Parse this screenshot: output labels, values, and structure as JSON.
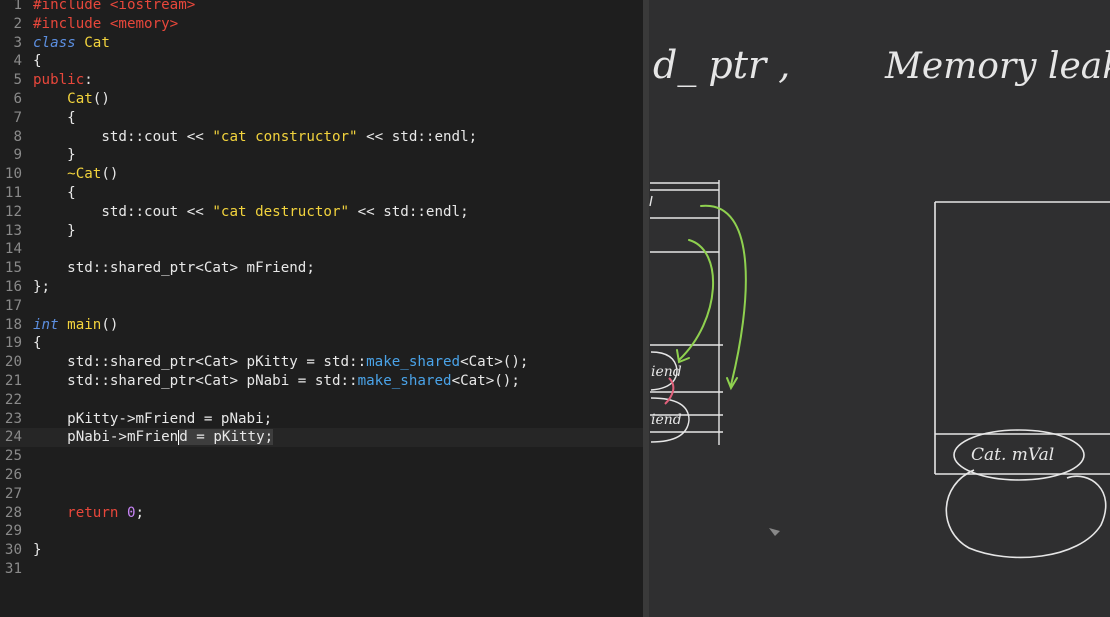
{
  "editor": {
    "current_line": 24,
    "caret": {
      "line": 24,
      "token": 1
    },
    "lines": [
      {
        "n": "1",
        "tokens": [
          {
            "t": "#include <iostream>",
            "c": "kw"
          }
        ]
      },
      {
        "n": "2",
        "tokens": [
          {
            "t": "#include <memory>",
            "c": "kw"
          }
        ]
      },
      {
        "n": "3",
        "tokens": [
          {
            "t": "class",
            "c": "it"
          },
          {
            "t": " Cat",
            "c": "fn"
          }
        ]
      },
      {
        "n": "4",
        "tokens": [
          {
            "t": "{",
            "c": "pl"
          }
        ]
      },
      {
        "n": "5",
        "tokens": [
          {
            "t": "public",
            "c": "kw"
          },
          {
            "t": ":",
            "c": "pl"
          }
        ]
      },
      {
        "n": "6",
        "tokens": [
          {
            "t": "    ",
            "c": "pl"
          },
          {
            "t": "Cat",
            "c": "fn"
          },
          {
            "t": "()",
            "c": "pl"
          }
        ]
      },
      {
        "n": "7",
        "tokens": [
          {
            "t": "    {",
            "c": "pl"
          }
        ]
      },
      {
        "n": "8",
        "tokens": [
          {
            "t": "        std::cout << ",
            "c": "pl"
          },
          {
            "t": "\"cat constructor\"",
            "c": "str"
          },
          {
            "t": " << std::endl;",
            "c": "pl"
          }
        ]
      },
      {
        "n": "9",
        "tokens": [
          {
            "t": "    }",
            "c": "pl"
          }
        ]
      },
      {
        "n": "10",
        "tokens": [
          {
            "t": "    ",
            "c": "pl"
          },
          {
            "t": "~Cat",
            "c": "fn"
          },
          {
            "t": "()",
            "c": "pl"
          }
        ]
      },
      {
        "n": "11",
        "tokens": [
          {
            "t": "    {",
            "c": "pl"
          }
        ]
      },
      {
        "n": "12",
        "tokens": [
          {
            "t": "        std::cout << ",
            "c": "pl"
          },
          {
            "t": "\"cat destructor\"",
            "c": "str"
          },
          {
            "t": " << std::endl;",
            "c": "pl"
          }
        ]
      },
      {
        "n": "13",
        "tokens": [
          {
            "t": "    }",
            "c": "pl"
          }
        ]
      },
      {
        "n": "14",
        "tokens": []
      },
      {
        "n": "15",
        "tokens": [
          {
            "t": "    std::shared_ptr<Cat> mFriend;",
            "c": "pl"
          }
        ]
      },
      {
        "n": "16",
        "tokens": [
          {
            "t": "};",
            "c": "pl"
          }
        ]
      },
      {
        "n": "17",
        "tokens": []
      },
      {
        "n": "18",
        "tokens": [
          {
            "t": "int",
            "c": "it"
          },
          {
            "t": " ",
            "c": "pl"
          },
          {
            "t": "main",
            "c": "fn"
          },
          {
            "t": "()",
            "c": "pl"
          }
        ]
      },
      {
        "n": "19",
        "tokens": [
          {
            "t": "{",
            "c": "pl"
          }
        ]
      },
      {
        "n": "20",
        "tokens": [
          {
            "t": "    std::shared_ptr<Cat> pKitty = std::",
            "c": "pl"
          },
          {
            "t": "make_shared",
            "c": "ms"
          },
          {
            "t": "<Cat>();",
            "c": "pl"
          }
        ]
      },
      {
        "n": "21",
        "tokens": [
          {
            "t": "    std::shared_ptr<Cat> pNabi = std::",
            "c": "pl"
          },
          {
            "t": "make_shared",
            "c": "ms"
          },
          {
            "t": "<Cat>();",
            "c": "pl"
          }
        ]
      },
      {
        "n": "22",
        "tokens": []
      },
      {
        "n": "23",
        "tokens": [
          {
            "t": "    pKitty->mFriend = pNabi;",
            "c": "pl"
          }
        ]
      },
      {
        "n": "24",
        "tokens": [
          {
            "t": "    pNabi->mFrien",
            "c": "pl"
          },
          {
            "t": "d = pKitty;",
            "c": "sel"
          }
        ]
      },
      {
        "n": "25",
        "tokens": []
      },
      {
        "n": "26",
        "tokens": []
      },
      {
        "n": "27",
        "tokens": []
      },
      {
        "n": "28",
        "tokens": [
          {
            "t": "    ",
            "c": "pl"
          },
          {
            "t": "return",
            "c": "kw"
          },
          {
            "t": " ",
            "c": "pl"
          },
          {
            "t": "0",
            "c": "num"
          },
          {
            "t": ";",
            "c": "pl"
          }
        ]
      },
      {
        "n": "29",
        "tokens": []
      },
      {
        "n": "30",
        "tokens": [
          {
            "t": "}",
            "c": "pl"
          }
        ]
      },
      {
        "n": "31",
        "tokens": []
      }
    ]
  },
  "board": {
    "title_left": "d_ ptr ,",
    "title_right": "Memory leak",
    "stack_label_1": "iend",
    "stack_label_2": "iend",
    "heap_label": "Cat. mVal"
  },
  "colors": {
    "keyword": "#e8473b",
    "type": "#5c8fe0",
    "function": "#f2d33d",
    "string": "#f2d33d",
    "number": "#c784f5",
    "make_shared": "#4aa3e8",
    "plain": "#e8e8e8",
    "chalk": "#e6e6e6",
    "arrow": "#8fd14f",
    "pink": "#e0607a"
  }
}
